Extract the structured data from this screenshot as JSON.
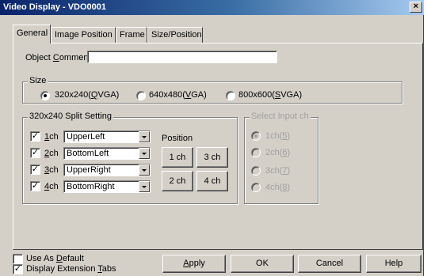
{
  "window": {
    "title": "Video Display - VDO0001",
    "close_glyph": "×"
  },
  "tabs": [
    {
      "label": "General",
      "active": true
    },
    {
      "label": "Image Position",
      "active": false
    },
    {
      "label": "Frame",
      "active": false
    },
    {
      "label": "Size/Position",
      "active": false
    }
  ],
  "object_comment": {
    "label_pre": "Object ",
    "label_key": "C",
    "label_post": "omment",
    "value": ""
  },
  "size": {
    "legend": "Size",
    "options": [
      {
        "pre": "320x240(",
        "key": "Q",
        "post": "VGA)",
        "checked": true
      },
      {
        "pre": "640x480(",
        "key": "V",
        "post": "GA)",
        "checked": false
      },
      {
        "pre": "800x600(",
        "key": "S",
        "post": "VGA)",
        "checked": false
      }
    ]
  },
  "split": {
    "legend": "320x240 Split Setting",
    "rows": [
      {
        "key": "1",
        "post": "ch",
        "checked": true,
        "value": "UpperLeft"
      },
      {
        "key": "2",
        "post": "ch",
        "checked": true,
        "value": "BottomLeft"
      },
      {
        "key": "3",
        "post": "ch",
        "checked": true,
        "value": "UpperRight"
      },
      {
        "key": "4",
        "post": "ch",
        "checked": true,
        "value": "BottomRight"
      }
    ],
    "position_label": "Position",
    "position_buttons": [
      "1 ch",
      "3 ch",
      "2 ch",
      "4 ch"
    ]
  },
  "select_input": {
    "legend": "Select Input ch",
    "options": [
      {
        "pre": "1ch(",
        "key": "5",
        "post": ")",
        "checked": true
      },
      {
        "pre": "2ch(",
        "key": "6",
        "post": ")",
        "checked": false
      },
      {
        "pre": "3ch(",
        "key": "7",
        "post": ")",
        "checked": false
      },
      {
        "pre": "4ch(",
        "key": "8",
        "post": ")",
        "checked": false
      }
    ]
  },
  "footer": {
    "use_default": {
      "pre": "Use As ",
      "key": "D",
      "post": "efault",
      "checked": false
    },
    "display_tabs": {
      "pre": "Display Extension ",
      "key": "T",
      "post": "abs",
      "checked": true
    },
    "apply": {
      "key": "A",
      "post": "pply"
    },
    "ok": "OK",
    "cancel": "Cancel",
    "help": "Help"
  },
  "checkmark_glyph": "✓"
}
